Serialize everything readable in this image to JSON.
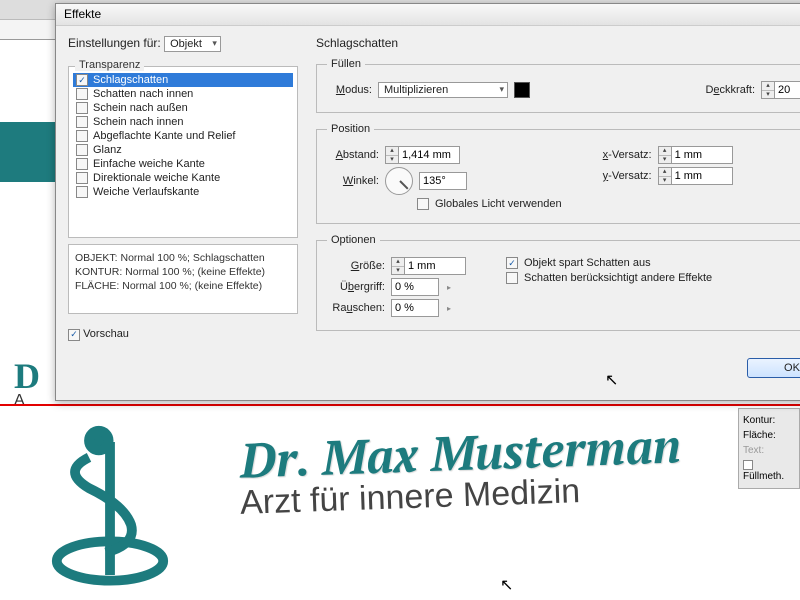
{
  "dialog": {
    "title": "Effekte",
    "settings_for_label": "Einstellungen für:",
    "settings_for_value": "Objekt",
    "transparency_group": "Transparenz",
    "fx": [
      {
        "label": "Schlagschatten",
        "checked": true,
        "selected": true
      },
      {
        "label": "Schatten nach innen",
        "checked": false
      },
      {
        "label": "Schein nach außen",
        "checked": false
      },
      {
        "label": "Schein nach innen",
        "checked": false
      },
      {
        "label": "Abgeflachte Kante und Relief",
        "checked": false
      },
      {
        "label": "Glanz",
        "checked": false
      },
      {
        "label": "Einfache weiche Kante",
        "checked": false
      },
      {
        "label": "Direktionale weiche Kante",
        "checked": false
      },
      {
        "label": "Weiche Verlaufskante",
        "checked": false
      }
    ],
    "summary": {
      "l1": "OBJEKT: Normal 100 %; Schlagschatten",
      "l2": "KONTUR: Normal 100 %; (keine Effekte)",
      "l3": "FLÄCHE: Normal 100 %; (keine Effekte)"
    },
    "preview_label": "Vorschau",
    "preview_checked": true,
    "panel_header": "Schlagschatten",
    "fill": {
      "legend": "Füllen",
      "mode_label": "Modus:",
      "mode_value": "Multiplizieren",
      "opacity_label": "Deckkraft:",
      "opacity_value": "20"
    },
    "position": {
      "legend": "Position",
      "distance_label": "Abstand:",
      "distance_value": "1,414 mm",
      "angle_label": "Winkel:",
      "angle_value": "135°",
      "xoff_label": "x-Versatz:",
      "xoff_value": "1 mm",
      "yoff_label": "y-Versatz:",
      "yoff_value": "1 mm",
      "global_light_label": "Globales Licht verwenden",
      "global_light_checked": false
    },
    "options": {
      "legend": "Optionen",
      "size_label": "Größe:",
      "size_value": "1 mm",
      "spread_label": "Übergriff:",
      "spread_value": "0 %",
      "noise_label": "Rauschen:",
      "noise_value": "0 %",
      "knockout_label": "Objekt spart Schatten aus",
      "knockout_checked": true,
      "honor_label": "Schatten berücksichtigt andere Effekte",
      "honor_checked": false
    },
    "ok_label": "OK"
  },
  "bg": {
    "title_partial": "D",
    "sub_partial": "A",
    "title_full": "Dr. Max Musterman",
    "sub_full": "Arzt für innere Medizin"
  },
  "side": {
    "kontur": "Kontur:",
    "flaeche": "Fläche:",
    "text": "Text:",
    "fullmeth": "Füllmeth."
  }
}
